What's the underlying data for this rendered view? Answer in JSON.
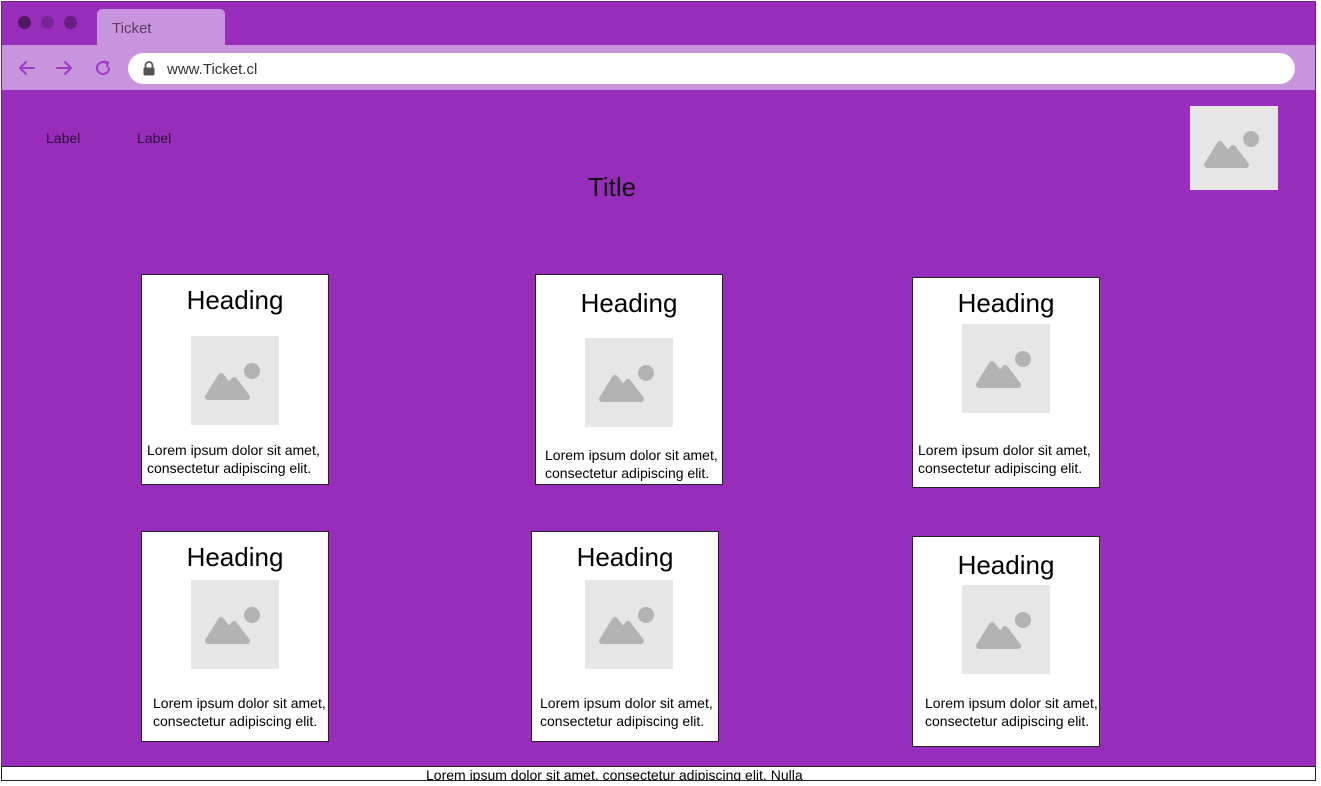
{
  "browser": {
    "tab_title": "Ticket",
    "url": "www.Ticket.cl"
  },
  "nav": {
    "labels": [
      "Label",
      "Label"
    ]
  },
  "page": {
    "title": "Title"
  },
  "cards": [
    {
      "heading": "Heading",
      "text_line1": "Lorem ipsum dolor sit amet,",
      "text_line2": "consectetur adipiscing elit."
    },
    {
      "heading": "Heading",
      "text_line1": "Lorem ipsum dolor sit amet,",
      "text_line2": "consectetur adipiscing elit."
    },
    {
      "heading": "Heading",
      "text_line1": "Lorem ipsum dolor sit amet,",
      "text_line2": "consectetur adipiscing elit."
    },
    {
      "heading": "Heading",
      "text_line1": "Lorem ipsum dolor sit amet,",
      "text_line2": "consectetur adipiscing elit."
    },
    {
      "heading": "Heading",
      "text_line1": "Lorem ipsum dolor sit amet,",
      "text_line2": "consectetur adipiscing elit."
    },
    {
      "heading": "Heading",
      "text_line1": "Lorem ipsum dolor sit amet,",
      "text_line2": "consectetur adipiscing elit."
    }
  ],
  "footer": {
    "text": "Lorem ipsum dolor sit amet, consectetur adipiscing elit. Nulla"
  },
  "colors": {
    "background": "#982cbb",
    "browser_chrome": "#c894dd",
    "card_background": "#ffffff",
    "image_placeholder": "#e6e6e6"
  },
  "icons": [
    "back-arrow-icon",
    "forward-arrow-icon",
    "reload-icon",
    "lock-icon",
    "image-placeholder-icon"
  ]
}
